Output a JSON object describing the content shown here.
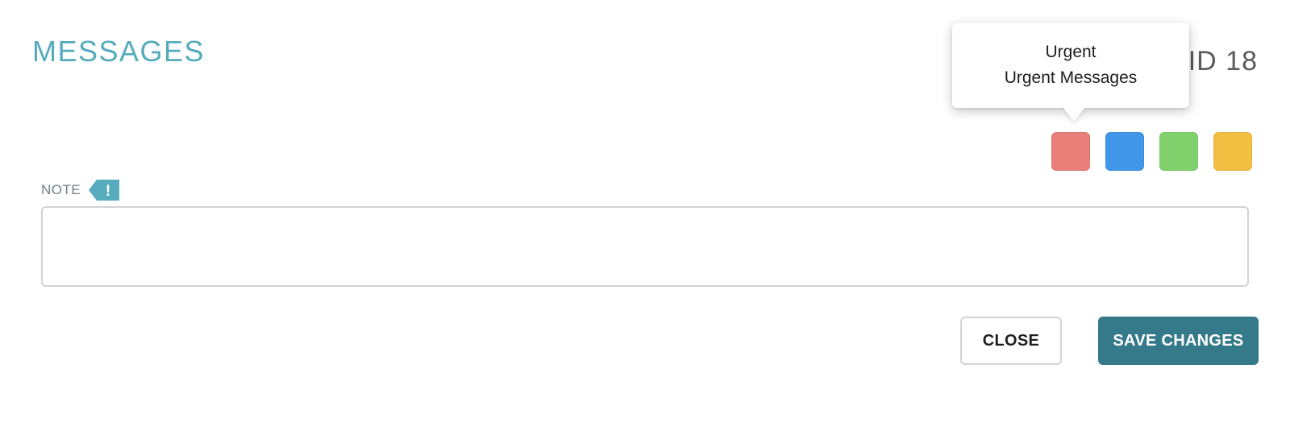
{
  "header": {
    "title": "MESSAGES",
    "record_id": "ID 18"
  },
  "tooltip": {
    "line1": "Urgent",
    "line2": "Urgent Messages"
  },
  "swatches": [
    {
      "name": "Urgent",
      "color": "#ea7f7a"
    },
    {
      "color": "#4196e8"
    },
    {
      "color": "#80d16c"
    },
    {
      "color": "#f1c043"
    }
  ],
  "note": {
    "label": "NOTE",
    "flag_icon": "exclamation-flag-icon",
    "flag_symbol": "!",
    "flag_color": "#56abbd",
    "value": "",
    "placeholder": ""
  },
  "buttons": {
    "close_label": "CLOSE",
    "save_label": "SAVE CHANGES"
  },
  "colors": {
    "accent": "#56abbd",
    "primary_button": "#357a8a"
  }
}
